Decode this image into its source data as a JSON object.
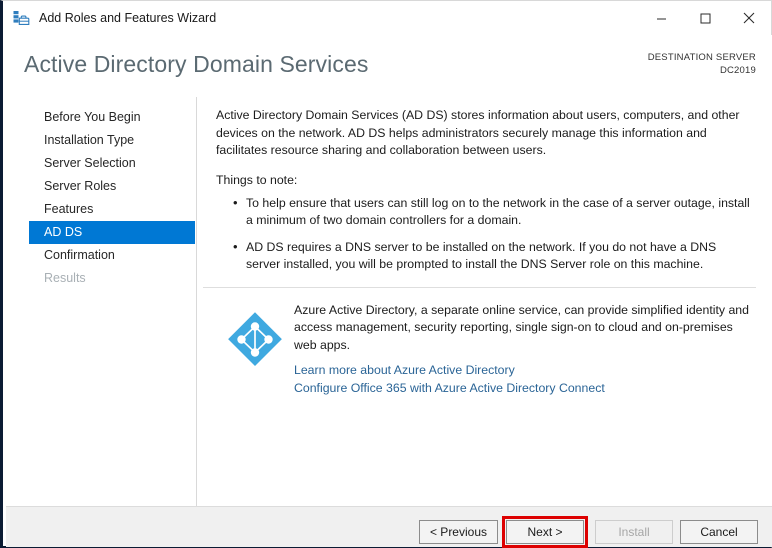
{
  "window": {
    "title": "Add Roles and Features Wizard",
    "app_icon": "roles-features-wizard-icon",
    "controls": {
      "minimize": "minimize-icon",
      "maximize": "maximize-icon",
      "close": "close-icon"
    }
  },
  "header": {
    "page_title": "Active Directory Domain Services",
    "destination_label": "DESTINATION SERVER",
    "destination_value": "DC2019"
  },
  "sidebar": {
    "items": [
      {
        "label": "Before You Begin",
        "state": "normal"
      },
      {
        "label": "Installation Type",
        "state": "normal"
      },
      {
        "label": "Server Selection",
        "state": "normal"
      },
      {
        "label": "Server Roles",
        "state": "normal"
      },
      {
        "label": "Features",
        "state": "normal"
      },
      {
        "label": "AD DS",
        "state": "selected"
      },
      {
        "label": "Confirmation",
        "state": "normal"
      },
      {
        "label": "Results",
        "state": "disabled"
      }
    ],
    "selected_background": "#0078d4",
    "selected_text_color": "#ffffff"
  },
  "content": {
    "intro_paragraph": "Active Directory Domain Services (AD DS) stores information about users, computers, and other devices on the network.  AD DS helps administrators securely manage this information and facilitates resource sharing and collaboration between users.",
    "things_to_note_label": "Things to note:",
    "notes": [
      "To help ensure that users can still log on to the network in the case of a server outage, install a minimum of two domain controllers for a domain.",
      "AD DS requires a DNS server to be installed on the network.  If you do not have a DNS server installed, you will be prompted to install the DNS Server role on this machine."
    ],
    "azure": {
      "icon": "azure-active-directory-icon",
      "icon_color": "#3fa9e0",
      "paragraph": "Azure Active Directory, a separate online service, can provide simplified identity and access management, security reporting, single sign-on to cloud and on-premises web apps.",
      "links": [
        "Learn more about Azure Active Directory",
        "Configure Office 365 with Azure Active Directory Connect"
      ],
      "link_color": "#2a6496"
    }
  },
  "footer": {
    "buttons": [
      {
        "label": "< Previous",
        "state": "enabled",
        "highlighted": false
      },
      {
        "label": "Next >",
        "state": "enabled",
        "highlighted": true
      },
      {
        "label": "Install",
        "state": "disabled",
        "highlighted": false
      },
      {
        "label": "Cancel",
        "state": "enabled",
        "highlighted": false
      }
    ],
    "highlight_color": "#dd0000"
  }
}
